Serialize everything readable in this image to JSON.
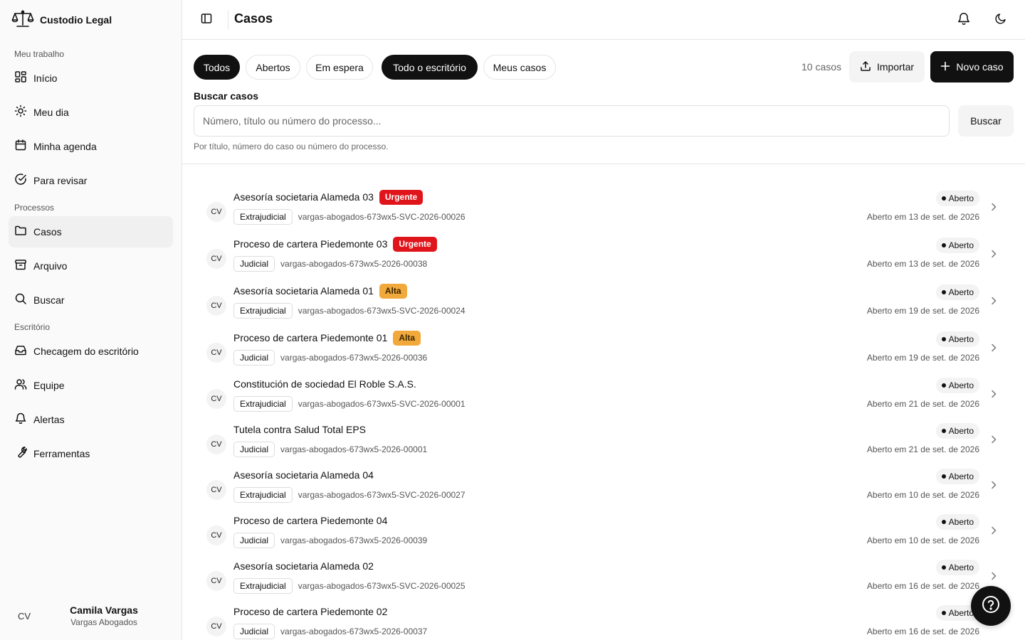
{
  "app": {
    "brand_name": "Custodio Legal"
  },
  "sidebar": {
    "sections": [
      "Meu trabalho",
      "Processos",
      "Escritório"
    ],
    "items": [
      {
        "label": "Início",
        "icon": "dashboard-icon"
      },
      {
        "label": "Meu dia",
        "icon": "sun-icon"
      },
      {
        "label": "Minha agenda",
        "icon": "calendar-icon"
      },
      {
        "label": "Para revisar",
        "icon": "check-circle-icon"
      },
      {
        "label": "Casos",
        "icon": "folder-icon",
        "active": true
      },
      {
        "label": "Arquivo",
        "icon": "archive-icon"
      },
      {
        "label": "Buscar",
        "icon": "search-icon"
      },
      {
        "label": "Checagem do escritório",
        "icon": "inbox-icon"
      },
      {
        "label": "Equipe",
        "icon": "users-icon"
      },
      {
        "label": "Alertas",
        "icon": "bell-icon"
      },
      {
        "label": "Ferramentas",
        "icon": "wrench-icon"
      }
    ],
    "user": {
      "initials": "CV",
      "name": "Camila Vargas",
      "org": "Vargas Abogados"
    }
  },
  "header": {
    "title": "Casos"
  },
  "filters": {
    "chips": [
      {
        "label": "Todos",
        "selected": true
      },
      {
        "label": "Abertos",
        "selected": false
      },
      {
        "label": "Em espera",
        "selected": false
      },
      {
        "label": "Todo o escritório",
        "selected": true
      },
      {
        "label": "Meus casos",
        "selected": false
      }
    ],
    "count": "10 casos",
    "import_label": "Importar",
    "new_label": "Novo caso"
  },
  "search": {
    "label": "Buscar casos",
    "placeholder": "Número, título ou número do processo...",
    "button": "Buscar",
    "help": "Por título, número do caso ou número do processo."
  },
  "cases": [
    {
      "initials": "CV",
      "title": "Asesoría societaria Alameda 03",
      "priority": "Urgente",
      "priority_level": "urgent",
      "type": "Extrajudicial",
      "number": "vargas-abogados-673wx5-SVC-2026-00026",
      "status": "Aberto",
      "opened": "Aberto em 13 de set. de 2026"
    },
    {
      "initials": "CV",
      "title": "Proceso de cartera Piedemonte 03",
      "priority": "Urgente",
      "priority_level": "urgent",
      "type": "Judicial",
      "number": "vargas-abogados-673wx5-2026-00038",
      "status": "Aberto",
      "opened": "Aberto em 13 de set. de 2026"
    },
    {
      "initials": "CV",
      "title": "Asesoría societaria Alameda 01",
      "priority": "Alta",
      "priority_level": "high",
      "type": "Extrajudicial",
      "number": "vargas-abogados-673wx5-SVC-2026-00024",
      "status": "Aberto",
      "opened": "Aberto em 19 de set. de 2026"
    },
    {
      "initials": "CV",
      "title": "Proceso de cartera Piedemonte 01",
      "priority": "Alta",
      "priority_level": "high",
      "type": "Judicial",
      "number": "vargas-abogados-673wx5-2026-00036",
      "status": "Aberto",
      "opened": "Aberto em 19 de set. de 2026"
    },
    {
      "initials": "CV",
      "title": "Constitución de sociedad El Roble S.A.S.",
      "priority": "",
      "priority_level": "",
      "type": "Extrajudicial",
      "number": "vargas-abogados-673wx5-SVC-2026-00001",
      "status": "Aberto",
      "opened": "Aberto em 21 de set. de 2026"
    },
    {
      "initials": "CV",
      "title": "Tutela contra Salud Total EPS",
      "priority": "",
      "priority_level": "",
      "type": "Judicial",
      "number": "vargas-abogados-673wx5-2026-00001",
      "status": "Aberto",
      "opened": "Aberto em 21 de set. de 2026"
    },
    {
      "initials": "CV",
      "title": "Asesoría societaria Alameda 04",
      "priority": "",
      "priority_level": "",
      "type": "Extrajudicial",
      "number": "vargas-abogados-673wx5-SVC-2026-00027",
      "status": "Aberto",
      "opened": "Aberto em 10 de set. de 2026"
    },
    {
      "initials": "CV",
      "title": "Proceso de cartera Piedemonte 04",
      "priority": "",
      "priority_level": "",
      "type": "Judicial",
      "number": "vargas-abogados-673wx5-2026-00039",
      "status": "Aberto",
      "opened": "Aberto em 10 de set. de 2026"
    },
    {
      "initials": "CV",
      "title": "Asesoría societaria Alameda 02",
      "priority": "",
      "priority_level": "",
      "type": "Extrajudicial",
      "number": "vargas-abogados-673wx5-SVC-2026-00025",
      "status": "Aberto",
      "opened": "Aberto em 16 de set. de 2026"
    },
    {
      "initials": "CV",
      "title": "Proceso de cartera Piedemonte 02",
      "priority": "",
      "priority_level": "",
      "type": "Judicial",
      "number": "vargas-abogados-673wx5-2026-00037",
      "status": "Aberto",
      "opened": "Aberto em 16 de set. de 2026"
    }
  ],
  "colors": {
    "urgent": "#e0151b",
    "high": "#f2a93b",
    "primary": "#111111"
  }
}
